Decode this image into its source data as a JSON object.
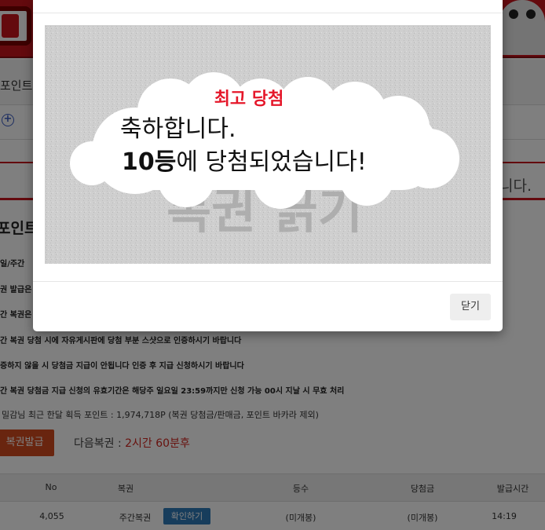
{
  "background": {
    "tab_text": "포인트",
    "notice_tail": "니다.",
    "section_title": "포인트",
    "rules": [
      "일/주간",
      "권 발급은",
      "간 복권은",
      "간 복권 당첨 시에 자유게시판에 당첨 부분 스샷으로 인증하시기 바랍니다",
      "증하지 않을 시 당첨금 지급이 안됩니다 인증 후 지급 신청하시기 바랍니다",
      "간 복권 당첨금 지급 신청의 유효기간은 해당주 일요일 23:59까지만 신청 가능 00시 지날 시 무효 처리"
    ],
    "points_line": "밀감님 최근 한달 획득 포인트 : 1,974,718P (복권 당첨금/판매금, 포인트 바카라 제외)",
    "issue_button": "복권발급",
    "next_lottery_label": "다음복권 : ",
    "next_lottery_value": "2시간 60분후",
    "table": {
      "headers": [
        "No",
        "복권",
        "등수",
        "당첨금",
        "발급시간"
      ],
      "row": {
        "no": "4,055",
        "ticket": "주간복권",
        "confirm": "확인하기",
        "rank": "(미개봉)",
        "prize": "(미개봉)",
        "time": "14:19"
      }
    }
  },
  "modal": {
    "scratch_title_faded": "복권 긁기",
    "scratch_top_text": "최고 당첨",
    "message_line1": "축하합니다.",
    "message_rank": "10등",
    "message_line2_rest": "에 당첨되었습니다!",
    "close_button": "닫기"
  },
  "colors": {
    "accent_red": "#c8141c",
    "button_orange": "#d24a1f",
    "button_blue": "#2f7ab8",
    "next_value_red": "#d0251e"
  }
}
